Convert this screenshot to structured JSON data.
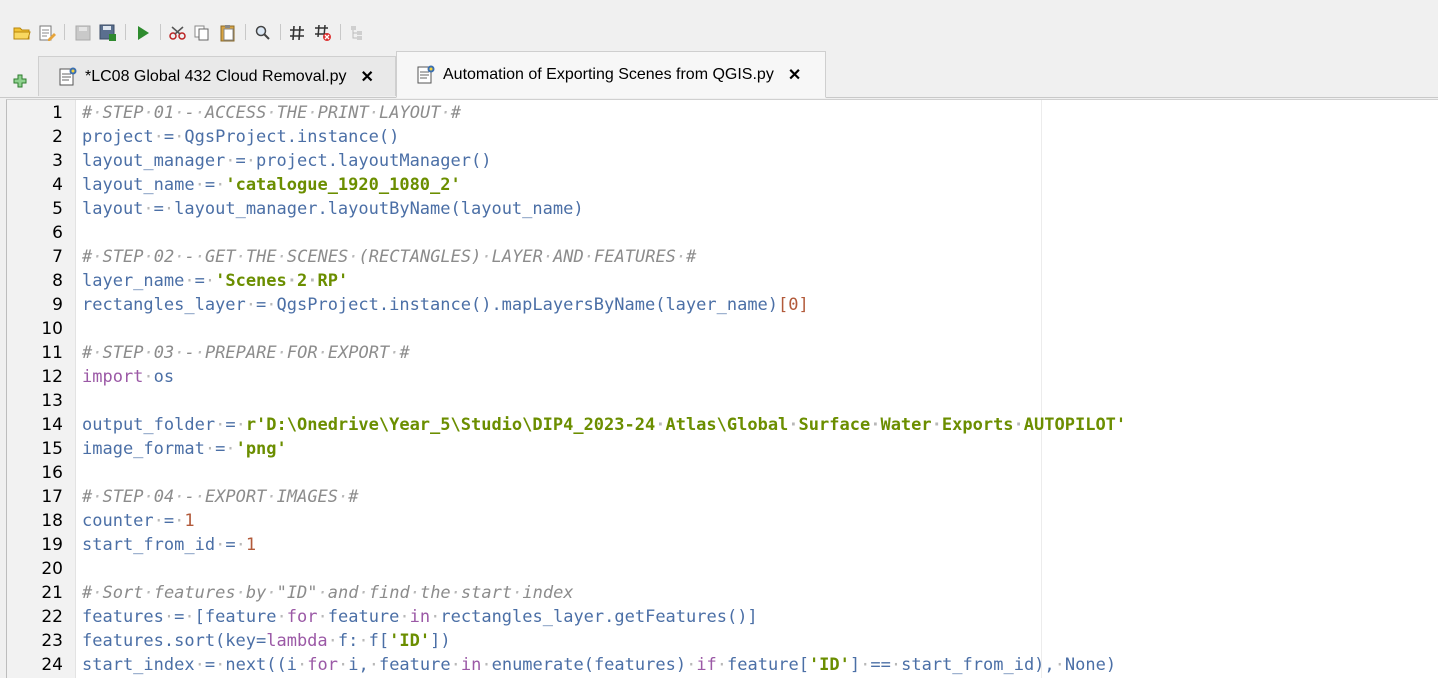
{
  "toolbar": {
    "icons": [
      "open-folder-icon",
      "edit-script-icon",
      "save-disabled-icon",
      "save-as-icon",
      "run-icon",
      "cut-icon",
      "copy-icon",
      "paste-icon",
      "find-icon",
      "comment-icon",
      "uncomment-icon",
      "object-inspector-icon"
    ]
  },
  "tabs": [
    {
      "label": "*LC08 Global 432 Cloud Removal.py",
      "active": false
    },
    {
      "label": "Automation of Exporting Scenes from QGIS.py",
      "active": true
    }
  ],
  "colors": {
    "comment": "#8c8c8c",
    "identifier": "#4b6fa6",
    "string": "#6b8e00",
    "number": "#b25a3a",
    "keyword": "#9b59a6",
    "whitespace_dot": "#b8b8b8"
  },
  "lines": [
    {
      "n": "1",
      "tokens": [
        [
          "c",
          "# STEP 01 - ACCESS THE PRINT LAYOUT #"
        ]
      ]
    },
    {
      "n": "2",
      "tokens": [
        [
          "p",
          "project = QgsProject.instance()"
        ]
      ]
    },
    {
      "n": "3",
      "tokens": [
        [
          "p",
          "layout_manager = project.layoutManager()"
        ]
      ]
    },
    {
      "n": "4",
      "tokens": [
        [
          "p",
          "layout_name = "
        ],
        [
          "s",
          "'catalogue_1920_1080_2'"
        ]
      ]
    },
    {
      "n": "5",
      "tokens": [
        [
          "p",
          "layout = layout_manager.layoutByName(layout_name)"
        ]
      ]
    },
    {
      "n": "6",
      "tokens": []
    },
    {
      "n": "7",
      "tokens": [
        [
          "c",
          "# STEP 02 - GET THE SCENES (RECTANGLES) LAYER AND FEATURES #"
        ]
      ]
    },
    {
      "n": "8",
      "tokens": [
        [
          "p",
          "layer_name = "
        ],
        [
          "s",
          "'Scenes 2 RP'"
        ]
      ]
    },
    {
      "n": "9",
      "tokens": [
        [
          "p",
          "rectangles_layer = QgsProject.instance().mapLayersByName(layer_name)"
        ],
        [
          "n",
          "[0]"
        ]
      ]
    },
    {
      "n": "10",
      "tokens": []
    },
    {
      "n": "11",
      "tokens": [
        [
          "c",
          "# STEP 03 - PREPARE FOR EXPORT #"
        ]
      ]
    },
    {
      "n": "12",
      "tokens": [
        [
          "k",
          "import"
        ],
        [
          "p",
          " os"
        ]
      ]
    },
    {
      "n": "13",
      "tokens": []
    },
    {
      "n": "14",
      "tokens": [
        [
          "p",
          "output_folder = "
        ],
        [
          "s",
          "r'D:\\Onedrive\\Year_5\\Studio\\DIP4_2023-24 Atlas\\Global Surface Water Exports AUTOPILOT'"
        ]
      ]
    },
    {
      "n": "15",
      "tokens": [
        [
          "p",
          "image_format = "
        ],
        [
          "s",
          "'png'"
        ]
      ]
    },
    {
      "n": "16",
      "tokens": []
    },
    {
      "n": "17",
      "tokens": [
        [
          "c",
          "# STEP 04 - EXPORT IMAGES #"
        ]
      ]
    },
    {
      "n": "18",
      "tokens": [
        [
          "p",
          "counter = "
        ],
        [
          "n",
          "1"
        ]
      ]
    },
    {
      "n": "19",
      "tokens": [
        [
          "p",
          "start_from_id = "
        ],
        [
          "n",
          "1"
        ]
      ]
    },
    {
      "n": "20",
      "tokens": []
    },
    {
      "n": "21",
      "tokens": [
        [
          "c",
          "# Sort features by \"ID\" and find the start index"
        ]
      ]
    },
    {
      "n": "22",
      "tokens": [
        [
          "p",
          "features = [feature "
        ],
        [
          "k",
          "for"
        ],
        [
          "p",
          " feature "
        ],
        [
          "k",
          "in"
        ],
        [
          "p",
          " rectangles_layer.getFeatures()]"
        ]
      ]
    },
    {
      "n": "23",
      "tokens": [
        [
          "p",
          "features.sort(key="
        ],
        [
          "k",
          "lambda"
        ],
        [
          "p",
          " f: f["
        ],
        [
          "s",
          "'ID'"
        ],
        [
          "p",
          "])"
        ]
      ]
    },
    {
      "n": "24",
      "tokens": [
        [
          "p",
          "start_index = next((i "
        ],
        [
          "k",
          "for"
        ],
        [
          "p",
          " i, feature "
        ],
        [
          "k",
          "in"
        ],
        [
          "p",
          " enumerate(features) "
        ],
        [
          "k",
          "if"
        ],
        [
          "p",
          " feature["
        ],
        [
          "s",
          "'ID'"
        ],
        [
          "p",
          "] == start_from_id), None)"
        ]
      ]
    }
  ]
}
